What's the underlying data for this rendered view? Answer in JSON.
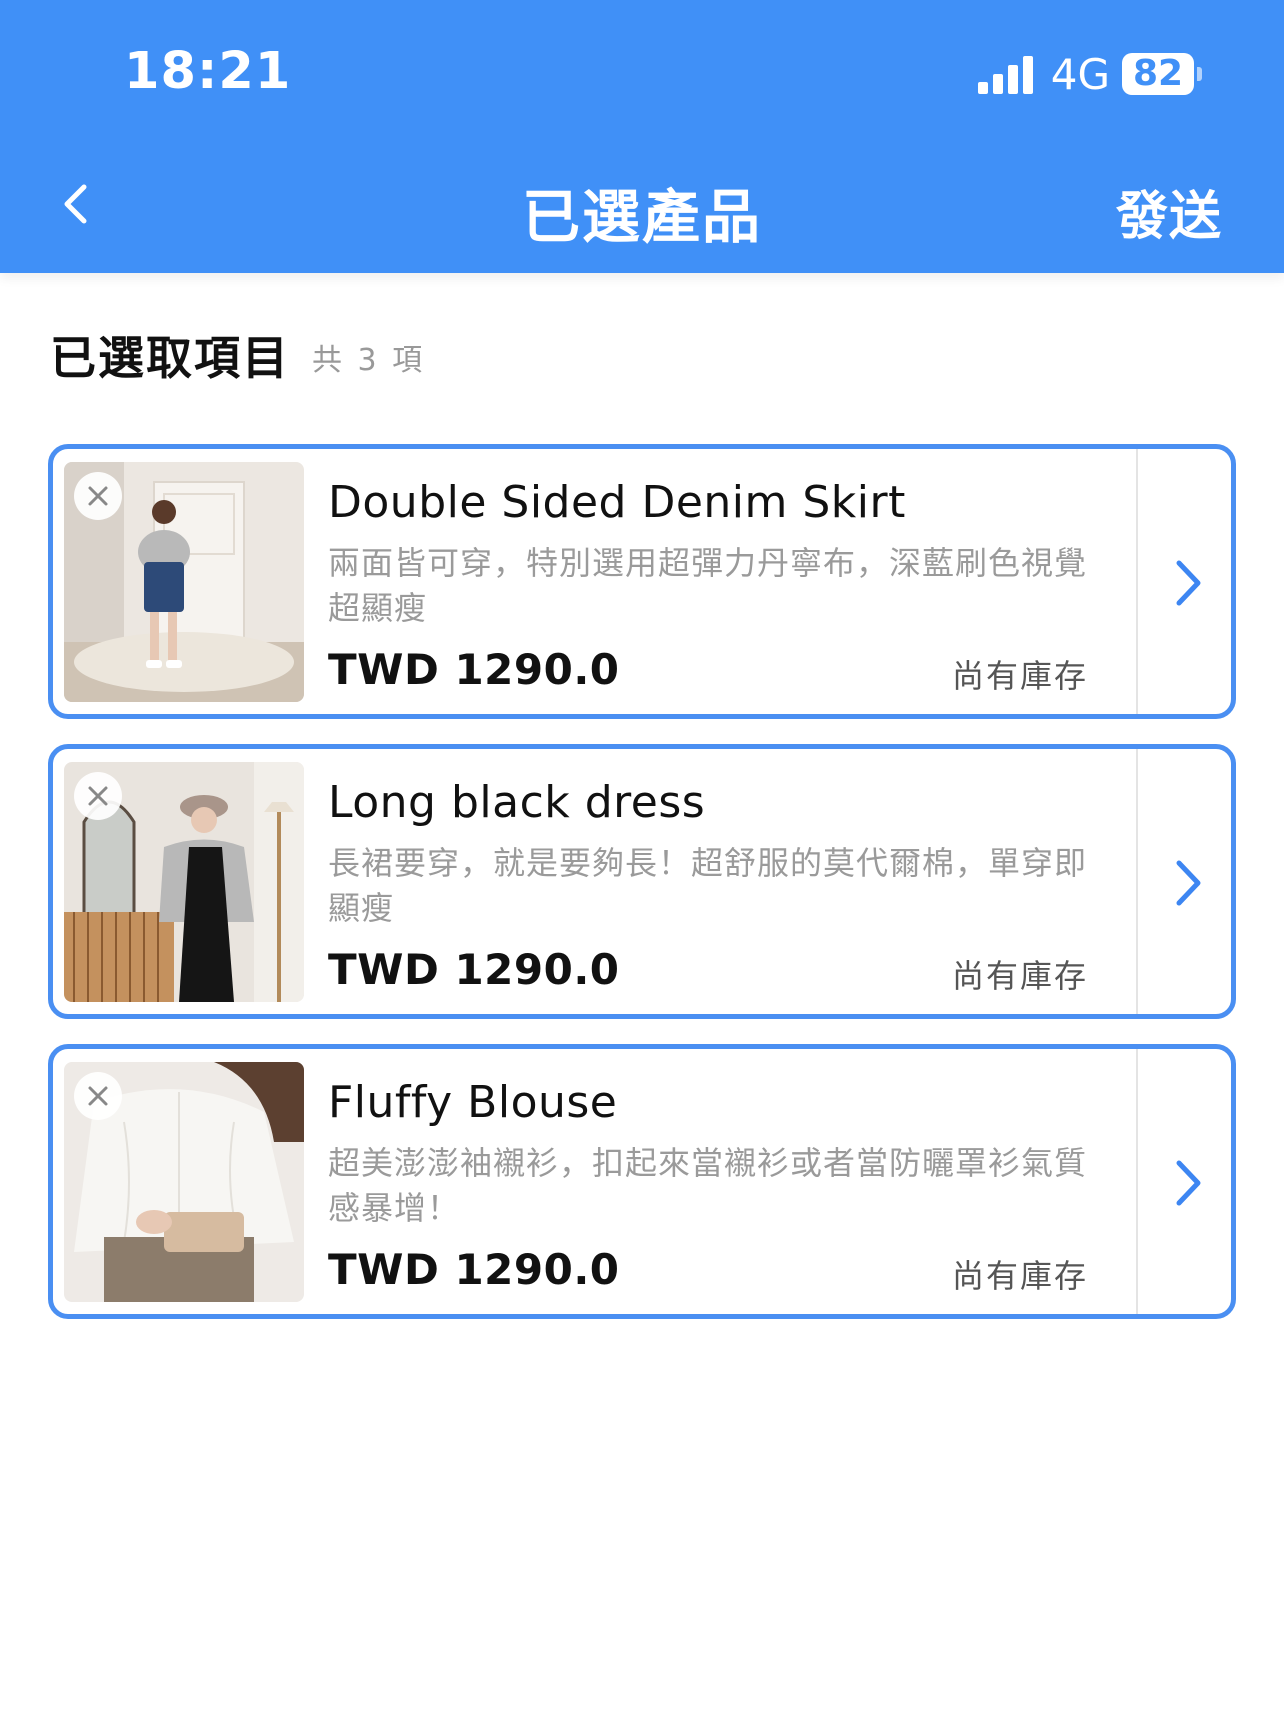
{
  "status_bar": {
    "time": "18:21",
    "network": "4G",
    "battery": "82"
  },
  "nav": {
    "title": "已選產品",
    "send_label": "發送"
  },
  "section": {
    "title": "已選取項目",
    "count_text": "共 3 項"
  },
  "colors": {
    "primary": "#4090f7",
    "card_border": "#4a8ff2",
    "muted_text": "#9a9a9a"
  },
  "items": [
    {
      "name": "Double Sided Denim Skirt",
      "description": "兩面皆可穿，特別選用超彈力丹寧布，深藍刷色視覺超顯瘦",
      "price": "TWD 1290.0",
      "stock": "尚有庫存"
    },
    {
      "name": "Long black dress",
      "description": "長裙要穿，就是要夠長！超舒服的莫代爾棉，單穿即顯瘦",
      "price": "TWD 1290.0",
      "stock": "尚有庫存"
    },
    {
      "name": "Fluffy Blouse",
      "description": "超美澎澎袖襯衫，扣起來當襯衫或者當防曬罩衫氣質感暴增！",
      "price": "TWD 1290.0",
      "stock": "尚有庫存"
    }
  ]
}
